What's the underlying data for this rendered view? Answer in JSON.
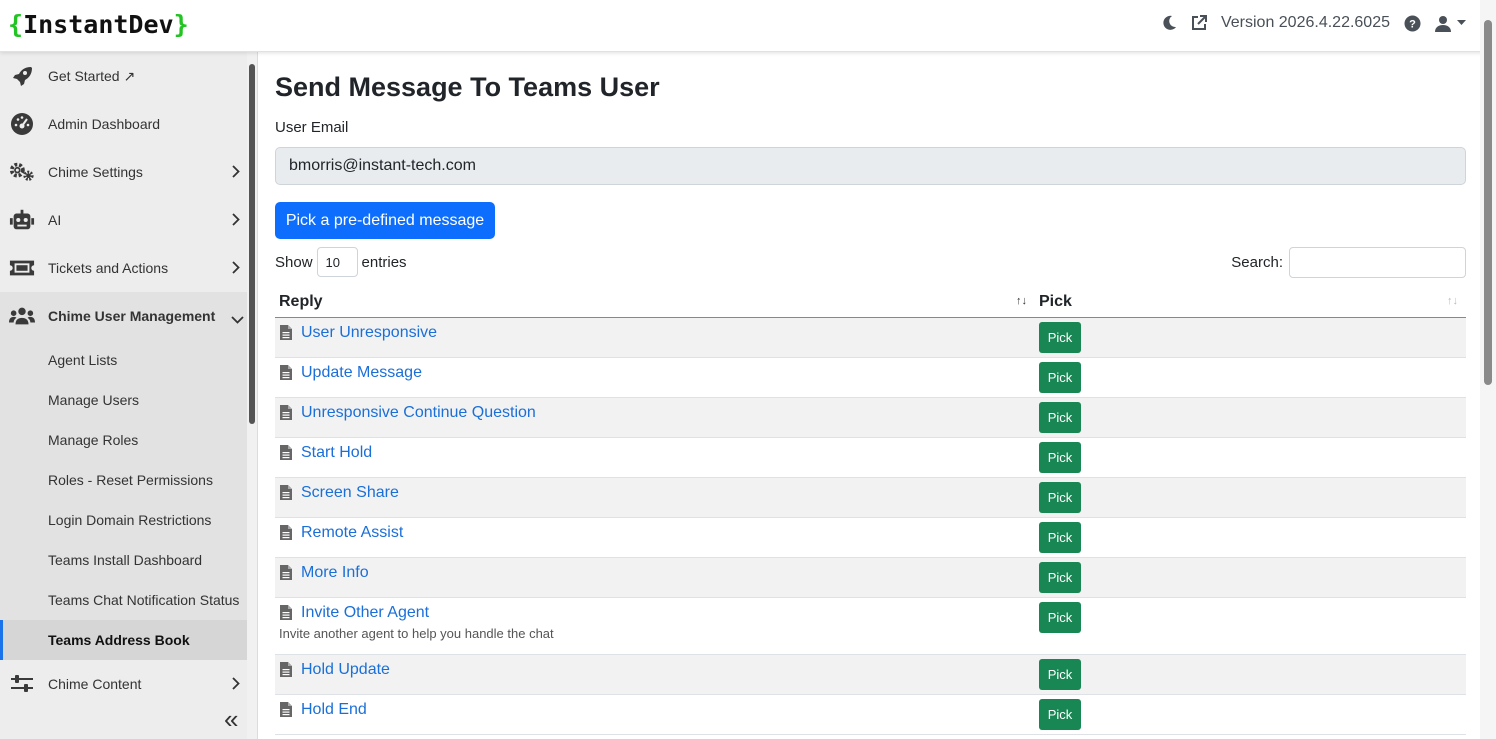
{
  "header": {
    "logo_open": "{",
    "logo_text": "InstantDev",
    "logo_close": "}",
    "version": "Version 2026.4.22.6025",
    "icons": [
      "moon-icon",
      "external-link-icon",
      "help-icon",
      "user-icon",
      "caret-down-icon"
    ]
  },
  "sidebar": {
    "items": [
      {
        "label": "Get Started ↗",
        "icon": "rocket-icon"
      },
      {
        "label": "Admin Dashboard",
        "icon": "gauge-icon"
      },
      {
        "label": "Chime Settings",
        "icon": "gears-icon"
      },
      {
        "label": "AI",
        "icon": "robot-icon"
      },
      {
        "label": "Tickets and Actions",
        "icon": "ticket-icon"
      },
      {
        "label": "Chime User Management",
        "icon": "users-icon"
      }
    ],
    "sub_items": [
      "Agent Lists",
      "Manage Users",
      "Manage Roles",
      "Roles - Reset Permissions",
      "Login Domain Restrictions",
      "Teams Install Dashboard",
      "Teams Chat Notification Status",
      "Teams Address Book"
    ],
    "after_item": {
      "label": "Chime Content",
      "icon": "sliders-icon"
    },
    "collapse_glyph": "«"
  },
  "main": {
    "title": "Send Message To Teams User",
    "email_label": "User Email",
    "email_value": "bmorris@instant-tech.com",
    "pick_message_button": "Pick a pre-defined message",
    "show_label": "Show",
    "entries_value": "10",
    "entries_label": "entries",
    "search_label": "Search:",
    "table": {
      "headers": [
        "Reply",
        "Pick"
      ],
      "rows": [
        {
          "reply": "User Unresponsive",
          "desc": ""
        },
        {
          "reply": "Update Message",
          "desc": ""
        },
        {
          "reply": "Unresponsive Continue Question",
          "desc": ""
        },
        {
          "reply": "Start Hold",
          "desc": ""
        },
        {
          "reply": "Screen Share",
          "desc": ""
        },
        {
          "reply": "Remote Assist",
          "desc": ""
        },
        {
          "reply": "More Info",
          "desc": ""
        },
        {
          "reply": "Invite Other Agent",
          "desc": "Invite another agent to help you handle the chat"
        },
        {
          "reply": "Hold Update",
          "desc": ""
        },
        {
          "reply": "Hold End",
          "desc": ""
        }
      ],
      "pick_label": "Pick"
    }
  },
  "colors": {
    "primary": "#0d6efd",
    "success": "#198754",
    "logo_brace": "#22c322"
  }
}
